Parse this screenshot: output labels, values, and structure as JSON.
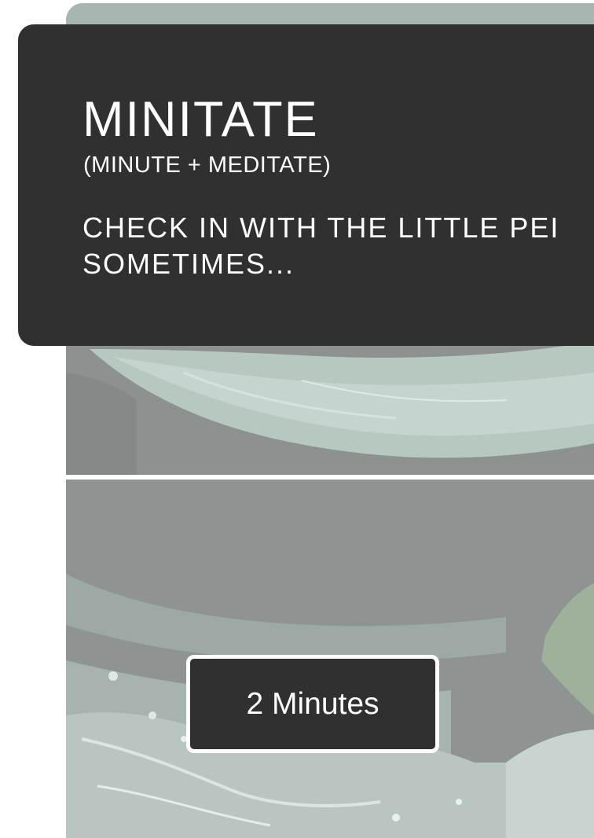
{
  "hero": {
    "title": "MINITATE",
    "subtitle": "(MINUTE + MEDITATE)",
    "body_line1": "CHECK IN WITH THE LITTLE PEI",
    "body_line2": "SOMETIMES..."
  },
  "timer_button": {
    "label": "2 Minutes"
  },
  "colors": {
    "card": "#303030",
    "text": "#ffffff",
    "background_photo": "#8f9392"
  }
}
